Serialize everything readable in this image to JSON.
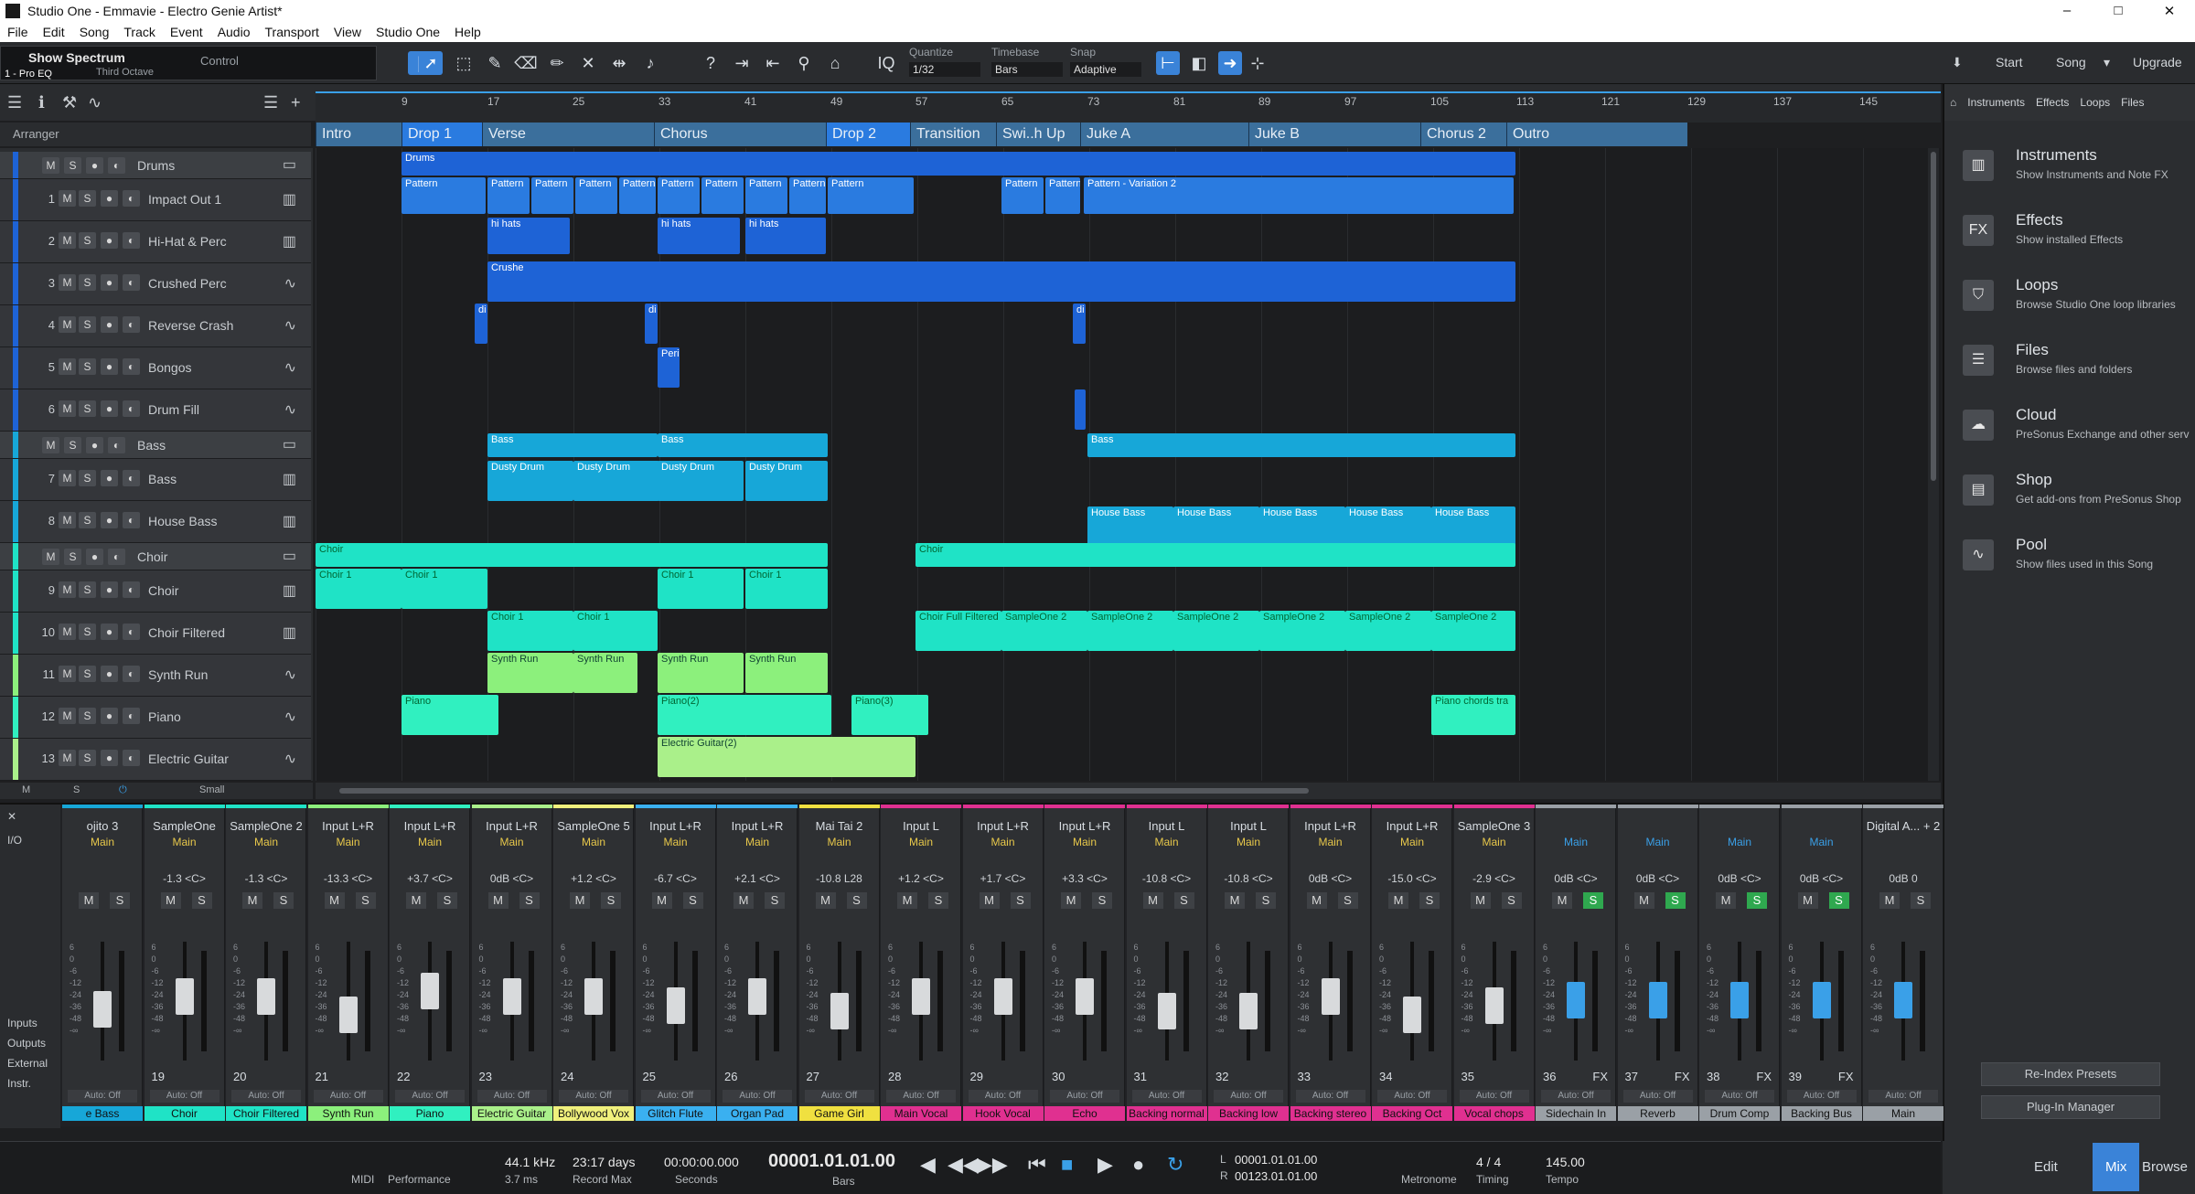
{
  "window": {
    "title": "Studio One - Emmavie - Electro Genie Artist*",
    "buttons": [
      "–",
      "□",
      "✕"
    ]
  },
  "menu": [
    "File",
    "Edit",
    "Song",
    "Track",
    "Event",
    "Audio",
    "Transport",
    "View",
    "Studio One",
    "Help"
  ],
  "toolbar": {
    "show_spectrum": "Show Spectrum",
    "octave": "Third Octave",
    "control": "Control",
    "insert": "1 - Pro EQ",
    "quantize_label": "Quantize",
    "quantize_value": "1/32",
    "timebase_label": "Timebase",
    "timebase_value": "Bars",
    "snap_label": "Snap",
    "snap_value": "Adaptive",
    "iq": "IQ",
    "start": "Start",
    "song": "Song",
    "upgrade": "Upgrade"
  },
  "arranger": {
    "label": "Arranger",
    "ruler": [
      "9",
      "17",
      "25",
      "33",
      "41",
      "49",
      "57",
      "65",
      "73",
      "81",
      "89",
      "97",
      "105",
      "113",
      "121",
      "129",
      "137",
      "145"
    ],
    "markers": [
      {
        "name": "Intro"
      },
      {
        "name": "Drop 1"
      },
      {
        "name": "Verse"
      },
      {
        "name": "Chorus"
      },
      {
        "name": "Drop 2"
      },
      {
        "name": "Transition"
      },
      {
        "name": "Swi..h Up"
      },
      {
        "name": "Juke A"
      },
      {
        "name": "Juke B"
      },
      {
        "name": "Chorus 2"
      },
      {
        "name": "Outro"
      }
    ],
    "footer_size": "Small"
  },
  "tracks": [
    {
      "num": "",
      "name": "Drums",
      "folder": true,
      "color": "#1e63d6"
    },
    {
      "num": "1",
      "name": "Impact Out 1",
      "color": "#1e63d6",
      "icon": "keys"
    },
    {
      "num": "2",
      "name": "Hi-Hat & Perc",
      "color": "#1e63d6",
      "icon": "keys"
    },
    {
      "num": "3",
      "name": "Crushed Perc",
      "color": "#1e63d6",
      "icon": "wave"
    },
    {
      "num": "4",
      "name": "Reverse Crash",
      "color": "#1e63d6",
      "icon": "wave"
    },
    {
      "num": "5",
      "name": "Bongos",
      "color": "#1e63d6",
      "icon": "wave"
    },
    {
      "num": "6",
      "name": "Drum Fill",
      "color": "#1e63d6",
      "icon": "wave"
    },
    {
      "num": "",
      "name": "Bass",
      "folder": true,
      "color": "#17a7d8"
    },
    {
      "num": "7",
      "name": "Bass",
      "color": "#17a7d8",
      "icon": "keys"
    },
    {
      "num": "8",
      "name": "House Bass",
      "color": "#17a7d8",
      "icon": "keys"
    },
    {
      "num": "",
      "name": "Choir",
      "folder": true,
      "color": "#1fe3c6"
    },
    {
      "num": "9",
      "name": "Choir",
      "color": "#1fe3c6",
      "icon": "keys"
    },
    {
      "num": "10",
      "name": "Choir Filtered",
      "color": "#1fe3c6",
      "icon": "keys"
    },
    {
      "num": "11",
      "name": "Synth Run",
      "color": "#8cf07c",
      "icon": "wave"
    },
    {
      "num": "12",
      "name": "Piano",
      "color": "#30f0c0",
      "icon": "wave"
    },
    {
      "num": "13",
      "name": "Electric Guitar",
      "color": "#aaf08a",
      "icon": "wave"
    }
  ],
  "clips": {
    "drums": "Drums",
    "pattern": "Pattern",
    "pattern_var": "Pattern - Variation 2",
    "hihats": "hi hats",
    "crushed": "Crushe",
    "di": "di",
    "peri": "Peri",
    "bass": "Bass",
    "dusty": "Dusty Drum",
    "house": "House Bass",
    "choir": "Choir",
    "choir1": "Choir 1",
    "choir_full": "Choir Full Filtered",
    "sampleone": "SampleOne 2",
    "synth": "Synth Run",
    "piano": "Piano",
    "piano2": "Piano(2)",
    "piano3": "Piano(3)",
    "piano_chords": "Piano chords tra",
    "guitar": "Electric Guitar(2)"
  },
  "browser": {
    "tabs": [
      "Instruments",
      "Effects",
      "Loops",
      "Files"
    ],
    "items": [
      {
        "title": "Instruments",
        "desc": "Show Instruments and Note FX",
        "icon": "piano-icon",
        "glyph": "▥"
      },
      {
        "title": "Effects",
        "desc": "Show installed Effects",
        "icon": "fx-icon",
        "glyph": "FX"
      },
      {
        "title": "Loops",
        "desc": "Browse Studio One loop libraries",
        "icon": "loop-icon",
        "glyph": "⛉"
      },
      {
        "title": "Files",
        "desc": "Browse files and folders",
        "icon": "files-icon",
        "glyph": "☰"
      },
      {
        "title": "Cloud",
        "desc": "PreSonus Exchange and other serv",
        "icon": "cloud-icon",
        "glyph": "☁"
      },
      {
        "title": "Shop",
        "desc": "Get add-ons from PreSonus Shop",
        "icon": "shop-icon",
        "glyph": "▤"
      },
      {
        "title": "Pool",
        "desc": "Show files used in this Song",
        "icon": "pool-icon",
        "glyph": "∿"
      }
    ],
    "reindex": "Re-Index Presets",
    "plugin_manager": "Plug-In Manager"
  },
  "mixer": {
    "side": [
      "I/O",
      "Inputs",
      "Outputs",
      "External",
      "Instr."
    ],
    "channels": [
      {
        "in": "ojito 3",
        "out": "Main",
        "pan": "",
        "num": "",
        "label": "e Bass",
        "color": "#17a7d8"
      },
      {
        "in": "SampleOne",
        "out": "Main",
        "pan": "-1.3 <C>",
        "num": "19",
        "label": "Choir",
        "color": "#1fe3c6"
      },
      {
        "in": "SampleOne 2",
        "out": "Main",
        "pan": "-1.3 <C>",
        "num": "20",
        "label": "Choir Filtered",
        "color": "#1fe3c6"
      },
      {
        "in": "Input L+R",
        "out": "Main",
        "pan": "-13.3 <C>",
        "num": "21",
        "label": "Synth Run",
        "color": "#8cf07c"
      },
      {
        "in": "Input L+R",
        "out": "Main",
        "pan": "+3.7 <C>",
        "num": "22",
        "label": "Piano",
        "color": "#30f0c0"
      },
      {
        "in": "Input L+R",
        "out": "Main",
        "pan": "0dB <C>",
        "num": "23",
        "label": "Electric Guitar",
        "color": "#aaf08a"
      },
      {
        "in": "SampleOne 5",
        "out": "Main",
        "pan": "+1.2 <C>",
        "num": "24",
        "label": "Bollywood Vox",
        "color": "#f0f07c"
      },
      {
        "in": "Input L+R",
        "out": "Main",
        "pan": "-6.7 <C>",
        "num": "25",
        "label": "Glitch Flute",
        "color": "#3ab0f0"
      },
      {
        "in": "Input L+R",
        "out": "Main",
        "pan": "+2.1 <C>",
        "num": "26",
        "label": "Organ Pad",
        "color": "#3ab0f0"
      },
      {
        "in": "Mai Tai 2",
        "out": "Main",
        "pan": "-10.8 L28",
        "num": "27",
        "label": "Game Girl",
        "color": "#f0e040"
      },
      {
        "in": "Input L",
        "out": "Main",
        "pan": "+1.2 <C>",
        "num": "28",
        "label": "Main Vocal",
        "color": "#e03090"
      },
      {
        "in": "Input L+R",
        "out": "Main",
        "pan": "+1.7 <C>",
        "num": "29",
        "label": "Hook Vocal",
        "color": "#e03090"
      },
      {
        "in": "Input L+R",
        "out": "Main",
        "pan": "+3.3 <C>",
        "num": "30",
        "label": "Echo",
        "color": "#e03090"
      },
      {
        "in": "Input L",
        "out": "Main",
        "pan": "-10.8 <C>",
        "num": "31",
        "label": "Backing normal",
        "color": "#e03090"
      },
      {
        "in": "Input L",
        "out": "Main",
        "pan": "-10.8 <C>",
        "num": "32",
        "label": "Backing low",
        "color": "#e03090"
      },
      {
        "in": "Input L+R",
        "out": "Main",
        "pan": "0dB <C>",
        "num": "33",
        "label": "Backing stereo",
        "color": "#e03090"
      },
      {
        "in": "Input L+R",
        "out": "Main",
        "pan": "-15.0 <C>",
        "num": "34",
        "label": "Backing Oct",
        "color": "#e03090"
      },
      {
        "in": "SampleOne 3",
        "out": "Main",
        "pan": "-2.9 <C>",
        "num": "35",
        "label": "Vocal chops",
        "color": "#e03090"
      },
      {
        "in": "",
        "out": "Main",
        "pan": "0dB <C>",
        "num": "36",
        "label": "Sidechain In",
        "color": "#9aa0a6"
      },
      {
        "in": "",
        "out": "Main",
        "pan": "0dB <C>",
        "num": "37",
        "label": "Reverb",
        "color": "#9aa0a6"
      },
      {
        "in": "",
        "out": "Main",
        "pan": "0dB <C>",
        "num": "38",
        "label": "Drum Comp",
        "color": "#9aa0a6"
      },
      {
        "in": "",
        "out": "Main",
        "pan": "0dB <C>",
        "num": "39",
        "label": "Backing Bus",
        "color": "#9aa0a6"
      },
      {
        "in": "Digital A... + 2",
        "out": "",
        "pan": "0dB 0",
        "num": "",
        "label": "Main",
        "color": "#9aa0a6"
      }
    ],
    "auto_off": "Auto: Off",
    "fx": "FX"
  },
  "transport": {
    "midi": "MIDI",
    "performance": "Performance",
    "sample_rate": "44.1 kHz",
    "latency": "3.7 ms",
    "record_max_value": "23:17 days",
    "record_max": "Record Max",
    "seconds_value": "00:00:00.000",
    "seconds": "Seconds",
    "position": "00001.01.01.00",
    "bars": "Bars",
    "loop_l": "00001.01.01.00",
    "loop_r": "00123.01.01.00",
    "metronome": "Metronome",
    "timing_value": "4 / 4",
    "timing": "Timing",
    "tempo_value": "145.00",
    "tempo": "Tempo"
  },
  "bottom_tabs": [
    "Edit",
    "Mix",
    "Browse"
  ]
}
